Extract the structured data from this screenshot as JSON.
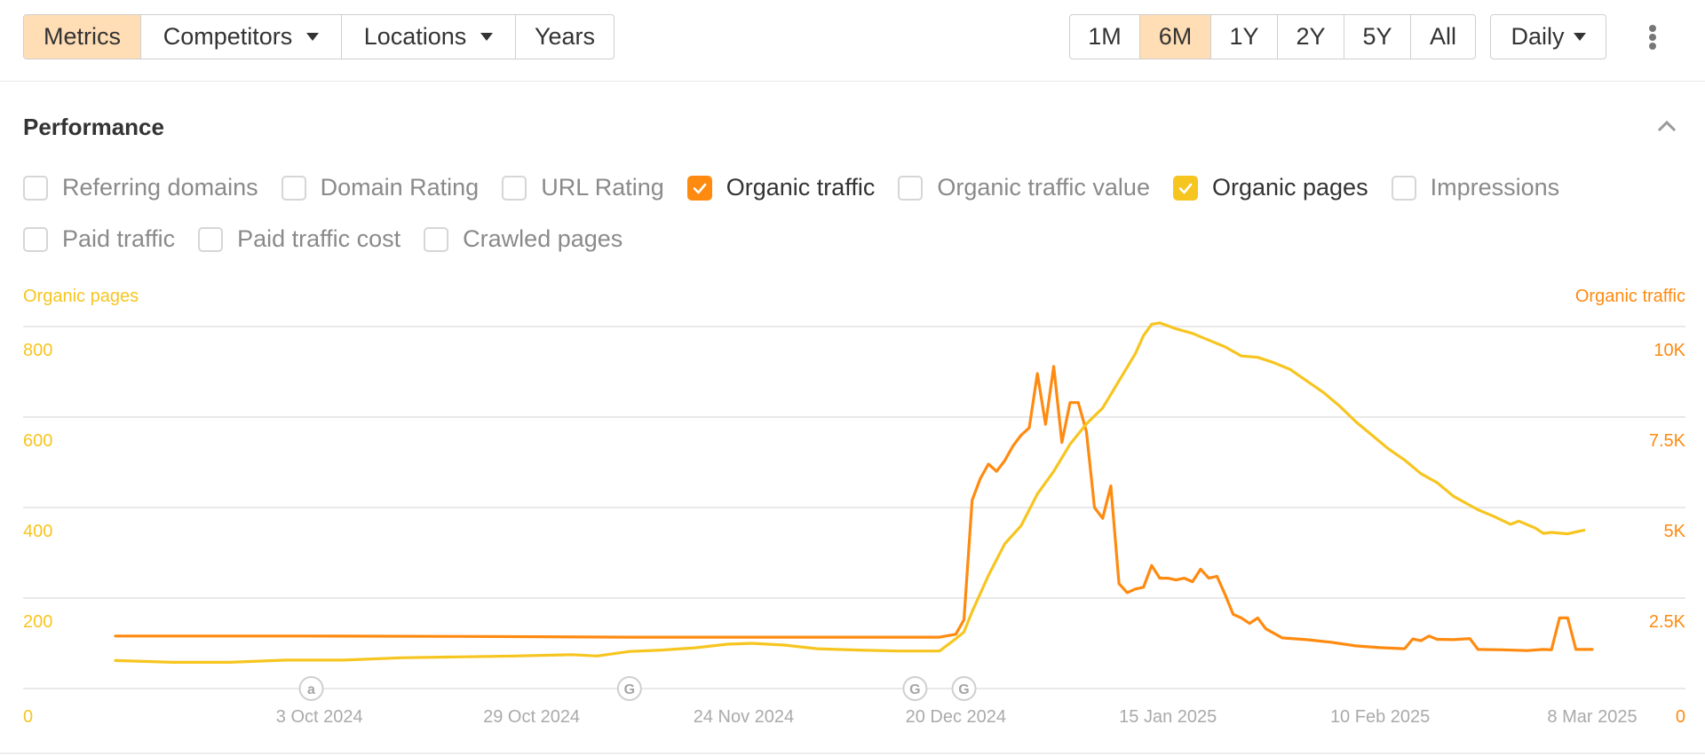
{
  "toolbar": {
    "left_buttons": [
      {
        "label": "Metrics",
        "active": true,
        "dropdown": false
      },
      {
        "label": "Competitors",
        "active": false,
        "dropdown": true
      },
      {
        "label": "Locations",
        "active": false,
        "dropdown": true
      },
      {
        "label": "Years",
        "active": false,
        "dropdown": false
      }
    ],
    "range_buttons": [
      {
        "label": "1M",
        "active": false
      },
      {
        "label": "6M",
        "active": true
      },
      {
        "label": "1Y",
        "active": false
      },
      {
        "label": "2Y",
        "active": false
      },
      {
        "label": "5Y",
        "active": false
      },
      {
        "label": "All",
        "active": false
      }
    ],
    "interval_select": {
      "label": "Daily"
    },
    "more_icon": "kebab-vertical-icon"
  },
  "section": {
    "title": "Performance",
    "collapse_icon": "chevron-up-icon"
  },
  "metric_checkboxes": {
    "row1": [
      {
        "label": "Referring domains",
        "checked": false
      },
      {
        "label": "Domain Rating",
        "checked": false
      },
      {
        "label": "URL Rating",
        "checked": false
      },
      {
        "label": "Organic traffic",
        "checked": true,
        "color": "#ff8a10"
      },
      {
        "label": "Organic traffic value",
        "checked": false
      },
      {
        "label": "Organic pages",
        "checked": true,
        "color": "#f7c520"
      },
      {
        "label": "Impressions",
        "checked": false
      }
    ],
    "row2": [
      {
        "label": "Paid traffic",
        "checked": false
      },
      {
        "label": "Paid traffic cost",
        "checked": false
      },
      {
        "label": "Crawled pages",
        "checked": false
      }
    ]
  },
  "colors": {
    "active_button_bg": "#ffddb5",
    "organic_traffic": "#ff8a10",
    "organic_pages": "#f7c520",
    "grid": "#e9e9e9",
    "date_label": "#aaaaaa",
    "annotation": "#b5b5b5"
  },
  "chart_data": {
    "type": "line",
    "title": "Performance",
    "left_axis": {
      "label": "Organic pages",
      "ticks": [
        "0",
        "200",
        "400",
        "600",
        "800"
      ],
      "range": [
        0,
        1000
      ]
    },
    "right_axis": {
      "label": "Organic traffic",
      "ticks": [
        "0",
        "2.5K",
        "5K",
        "7.5K",
        "10K"
      ],
      "range": [
        0,
        12500
      ]
    },
    "x_axis": {
      "start": "2024-09-08",
      "end": "2025-03-08",
      "tick_labels": [
        {
          "date": "2024-10-03",
          "label": "3 Oct 2024"
        },
        {
          "date": "2024-10-29",
          "label": "29 Oct 2024"
        },
        {
          "date": "2024-11-24",
          "label": "24 Nov 2024"
        },
        {
          "date": "2024-12-20",
          "label": "20 Dec 2024"
        },
        {
          "date": "2025-01-15",
          "label": "15 Jan 2025"
        },
        {
          "date": "2025-02-10",
          "label": "10 Feb 2025"
        },
        {
          "date": "2025-03-08",
          "label": "8 Mar 2025"
        }
      ]
    },
    "grid": true,
    "annotations": [
      {
        "date": "2024-10-02",
        "icon": "a"
      },
      {
        "date": "2024-11-10",
        "icon": "G"
      },
      {
        "date": "2024-12-15",
        "icon": "G"
      },
      {
        "date": "2024-12-21",
        "icon": "G"
      }
    ],
    "series": [
      {
        "name": "Organic traffic",
        "axis": "right",
        "color": "#ff8a10",
        "points": [
          [
            "2024-09-08",
            1450
          ],
          [
            "2024-10-01",
            1450
          ],
          [
            "2024-10-20",
            1440
          ],
          [
            "2024-11-10",
            1420
          ],
          [
            "2024-12-01",
            1420
          ],
          [
            "2024-12-18",
            1420
          ],
          [
            "2024-12-20",
            1500
          ],
          [
            "2024-12-21",
            1900
          ],
          [
            "2024-12-22",
            5200
          ],
          [
            "2024-12-23",
            5800
          ],
          [
            "2024-12-24",
            6200
          ],
          [
            "2024-12-25",
            6000
          ],
          [
            "2024-12-26",
            6300
          ],
          [
            "2024-12-27",
            6700
          ],
          [
            "2024-12-28",
            7000
          ],
          [
            "2024-12-29",
            7200
          ],
          [
            "2024-12-30",
            8700
          ],
          [
            "2024-12-31",
            7300
          ],
          [
            "2025-01-01",
            8900
          ],
          [
            "2025-01-02",
            6800
          ],
          [
            "2025-01-03",
            7900
          ],
          [
            "2025-01-04",
            7900
          ],
          [
            "2025-01-05",
            7100
          ],
          [
            "2025-01-06",
            5000
          ],
          [
            "2025-01-07",
            4700
          ],
          [
            "2025-01-08",
            5600
          ],
          [
            "2025-01-09",
            2900
          ],
          [
            "2025-01-10",
            2650
          ],
          [
            "2025-01-11",
            2750
          ],
          [
            "2025-01-12",
            2800
          ],
          [
            "2025-01-13",
            3400
          ],
          [
            "2025-01-14",
            3050
          ],
          [
            "2025-01-15",
            3050
          ],
          [
            "2025-01-16",
            3000
          ],
          [
            "2025-01-17",
            3050
          ],
          [
            "2025-01-18",
            2950
          ],
          [
            "2025-01-19",
            3300
          ],
          [
            "2025-01-20",
            3050
          ],
          [
            "2025-01-21",
            3100
          ],
          [
            "2025-01-22",
            2600
          ],
          [
            "2025-01-23",
            2050
          ],
          [
            "2025-01-24",
            1950
          ],
          [
            "2025-01-25",
            1800
          ],
          [
            "2025-01-26",
            1950
          ],
          [
            "2025-01-27",
            1650
          ],
          [
            "2025-01-29",
            1400
          ],
          [
            "2025-02-01",
            1350
          ],
          [
            "2025-02-04",
            1280
          ],
          [
            "2025-02-07",
            1180
          ],
          [
            "2025-02-10",
            1130
          ],
          [
            "2025-02-13",
            1100
          ],
          [
            "2025-02-14",
            1370
          ],
          [
            "2025-02-15",
            1320
          ],
          [
            "2025-02-16",
            1450
          ],
          [
            "2025-02-17",
            1360
          ],
          [
            "2025-02-19",
            1350
          ],
          [
            "2025-02-21",
            1380
          ],
          [
            "2025-02-22",
            1080
          ],
          [
            "2025-02-25",
            1070
          ],
          [
            "2025-02-28",
            1050
          ],
          [
            "2025-03-02",
            1080
          ],
          [
            "2025-03-03",
            1070
          ],
          [
            "2025-03-04",
            1950
          ],
          [
            "2025-03-05",
            1950
          ],
          [
            "2025-03-06",
            1080
          ],
          [
            "2025-03-08",
            1080
          ]
        ]
      },
      {
        "name": "Organic pages",
        "axis": "left",
        "color": "#f7c520",
        "points": [
          [
            "2024-09-08",
            62
          ],
          [
            "2024-09-15",
            58
          ],
          [
            "2024-09-22",
            58
          ],
          [
            "2024-09-29",
            63
          ],
          [
            "2024-10-06",
            63
          ],
          [
            "2024-10-13",
            68
          ],
          [
            "2024-10-20",
            70
          ],
          [
            "2024-10-27",
            72
          ],
          [
            "2024-11-03",
            75
          ],
          [
            "2024-11-06",
            72
          ],
          [
            "2024-11-10",
            82
          ],
          [
            "2024-11-14",
            85
          ],
          [
            "2024-11-18",
            90
          ],
          [
            "2024-11-22",
            98
          ],
          [
            "2024-11-25",
            100
          ],
          [
            "2024-11-29",
            96
          ],
          [
            "2024-12-03",
            88
          ],
          [
            "2024-12-08",
            85
          ],
          [
            "2024-12-13",
            83
          ],
          [
            "2024-12-18",
            83
          ],
          [
            "2024-12-20",
            110
          ],
          [
            "2024-12-21",
            125
          ],
          [
            "2024-12-22",
            170
          ],
          [
            "2024-12-24",
            250
          ],
          [
            "2024-12-26",
            320
          ],
          [
            "2024-12-28",
            360
          ],
          [
            "2024-12-30",
            430
          ],
          [
            "2025-01-01",
            480
          ],
          [
            "2025-01-03",
            540
          ],
          [
            "2025-01-05",
            585
          ],
          [
            "2025-01-07",
            620
          ],
          [
            "2025-01-09",
            680
          ],
          [
            "2025-01-11",
            740
          ],
          [
            "2025-01-12",
            780
          ],
          [
            "2025-01-13",
            805
          ],
          [
            "2025-01-14",
            808
          ],
          [
            "2025-01-16",
            795
          ],
          [
            "2025-01-18",
            785
          ],
          [
            "2025-01-20",
            770
          ],
          [
            "2025-01-22",
            755
          ],
          [
            "2025-01-24",
            735
          ],
          [
            "2025-01-26",
            732
          ],
          [
            "2025-01-28",
            720
          ],
          [
            "2025-01-30",
            705
          ],
          [
            "2025-02-01",
            680
          ],
          [
            "2025-02-03",
            655
          ],
          [
            "2025-02-05",
            625
          ],
          [
            "2025-02-07",
            590
          ],
          [
            "2025-02-09",
            560
          ],
          [
            "2025-02-11",
            530
          ],
          [
            "2025-02-13",
            505
          ],
          [
            "2025-02-15",
            475
          ],
          [
            "2025-02-17",
            455
          ],
          [
            "2025-02-19",
            425
          ],
          [
            "2025-02-21",
            405
          ],
          [
            "2025-02-22",
            395
          ],
          [
            "2025-02-24",
            380
          ],
          [
            "2025-02-26",
            363
          ],
          [
            "2025-02-27",
            370
          ],
          [
            "2025-03-01",
            355
          ],
          [
            "2025-03-02",
            343
          ],
          [
            "2025-03-03",
            345
          ],
          [
            "2025-03-05",
            342
          ],
          [
            "2025-03-07",
            350
          ]
        ]
      }
    ]
  }
}
